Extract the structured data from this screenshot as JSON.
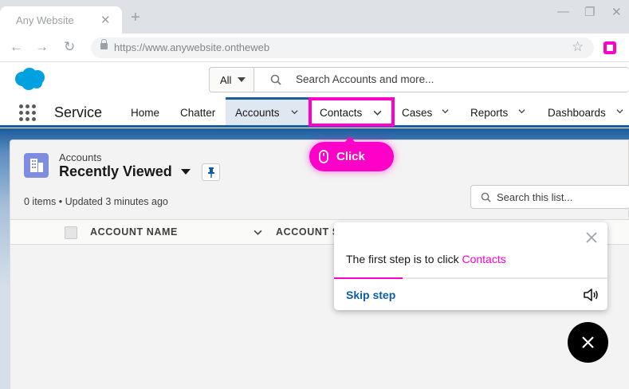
{
  "browser": {
    "tab_title": "Any Website",
    "tab_close": "✕",
    "new_tab": "+",
    "win_minimize": "—",
    "win_restore": "❐",
    "win_close": "✕",
    "back": "←",
    "forward": "→",
    "reload": "↻",
    "url": "https://www.anywebsite.ontheweb",
    "bookmark": "☆"
  },
  "header": {
    "search_scope": "All",
    "search_placeholder": "Search Accounts and more..."
  },
  "nav": {
    "app_name": "Service",
    "items": [
      {
        "label": "Home"
      },
      {
        "label": "Chatter"
      },
      {
        "label": "Accounts"
      },
      {
        "label": "Contacts"
      },
      {
        "label": "Cases"
      },
      {
        "label": "Reports"
      },
      {
        "label": "Dashboards"
      }
    ]
  },
  "list_view": {
    "object": "Accounts",
    "title": "Recently Viewed",
    "status": "0 items • Updated 3 minutes ago",
    "search_placeholder": "Search this list...",
    "columns": [
      "ACCOUNT NAME",
      "ACCOUNT S"
    ]
  },
  "walkthrough": {
    "click_label": "Click",
    "tooltip_prefix": "The first step is to click ",
    "tooltip_link": "Contacts",
    "skip_label": "Skip step",
    "progress": 0.25
  },
  "colors": {
    "highlight": "#ff00c8",
    "nav_accent": "#1b5c9e",
    "link": "#0b5cab"
  }
}
